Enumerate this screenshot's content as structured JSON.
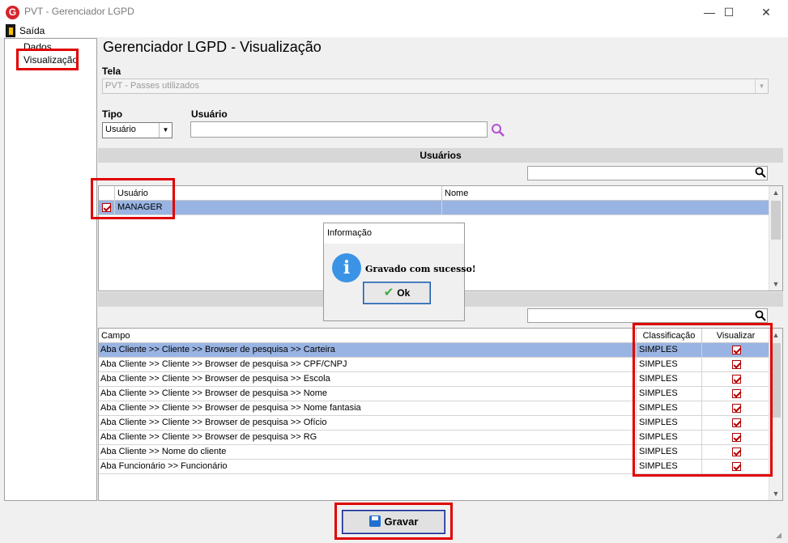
{
  "window": {
    "title": "PVT - Gerenciador LGPD",
    "minimize": "—",
    "maximize": "☐",
    "close": "✕"
  },
  "menu": {
    "exit_label": "Saída"
  },
  "nav": {
    "items": [
      {
        "label": "Dados"
      },
      {
        "label": "Visualização"
      }
    ]
  },
  "page_title": "Gerenciador LGPD - Visualização",
  "tela": {
    "label": "Tela",
    "value": "PVT - Passes utilizados"
  },
  "tipo": {
    "label": "Tipo",
    "value": "Usuário"
  },
  "usuario": {
    "label": "Usuário",
    "value": ""
  },
  "users_section": {
    "title": "Usuários",
    "search_value": "",
    "columns": [
      "Usuário",
      "Nome"
    ],
    "rows": [
      {
        "usuario": "MANAGER",
        "nome": "",
        "checked": true
      }
    ]
  },
  "fields_section": {
    "search_value": "",
    "columns": [
      "Campo",
      "Classificação",
      "Visualizar"
    ],
    "rows": [
      {
        "campo": "Aba Cliente >> Cliente >> Browser de pesquisa >> Carteira",
        "classificacao": "SIMPLES",
        "visualizar": true
      },
      {
        "campo": "Aba Cliente >> Cliente >> Browser de pesquisa >> CPF/CNPJ",
        "classificacao": "SIMPLES",
        "visualizar": true
      },
      {
        "campo": "Aba Cliente >> Cliente >> Browser de pesquisa >> Escola",
        "classificacao": "SIMPLES",
        "visualizar": true
      },
      {
        "campo": "Aba Cliente >> Cliente >> Browser de pesquisa >> Nome",
        "classificacao": "SIMPLES",
        "visualizar": true
      },
      {
        "campo": "Aba Cliente >> Cliente >> Browser de pesquisa >> Nome fantasia",
        "classificacao": "SIMPLES",
        "visualizar": true
      },
      {
        "campo": "Aba Cliente >> Cliente >> Browser de pesquisa >> Ofício",
        "classificacao": "SIMPLES",
        "visualizar": true
      },
      {
        "campo": "Aba Cliente >> Cliente >> Browser de pesquisa >> RG",
        "classificacao": "SIMPLES",
        "visualizar": true
      },
      {
        "campo": "Aba Cliente >> Nome do cliente",
        "classificacao": "SIMPLES",
        "visualizar": true
      },
      {
        "campo": "Aba Funcionário >> Funcionário",
        "classificacao": "SIMPLES",
        "visualizar": true
      }
    ]
  },
  "dialog": {
    "title": "Informação",
    "icon": "i",
    "message": "Gravado com sucesso!",
    "ok_label": "Ok"
  },
  "gravar_label": "Gravar",
  "colors": {
    "highlight": "#e00000",
    "selected_row": "#99b4e3",
    "info_icon": "#3b93e6"
  }
}
